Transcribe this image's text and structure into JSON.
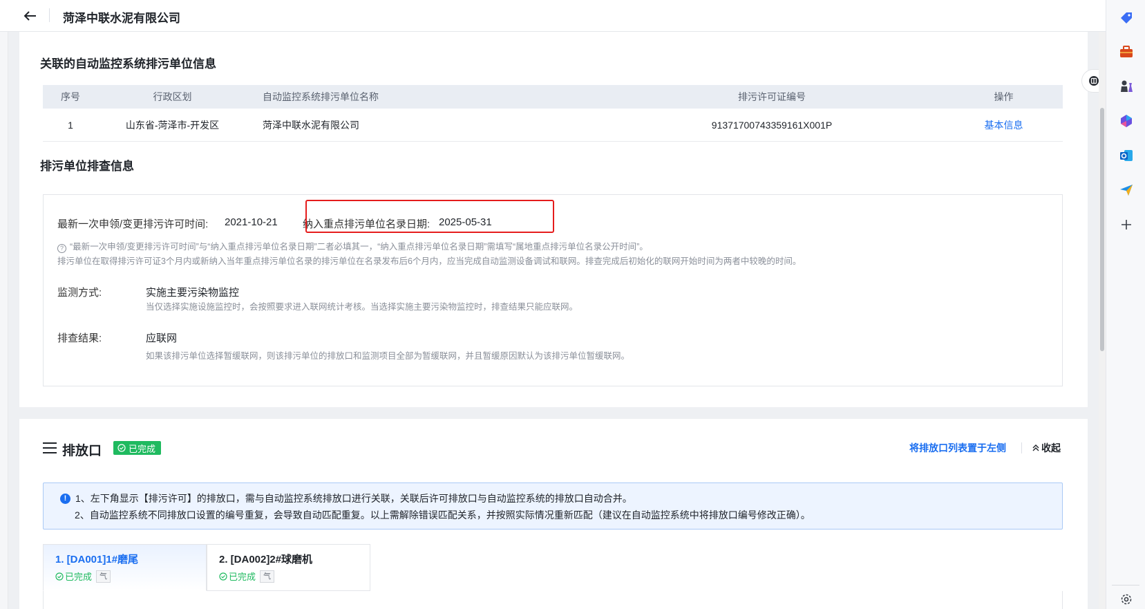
{
  "header": {
    "title": "菏泽中联水泥有限公司",
    "back_icon": "arrow-left-icon"
  },
  "linked_units": {
    "title": "关联的自动监控系统排污单位信息",
    "columns": [
      "序号",
      "行政区划",
      "自动监控系统排污单位名称",
      "排污许可证编号",
      "操作"
    ],
    "rows": [
      {
        "index": "1",
        "region": "山东省-菏泽市-开发区",
        "name": "菏泽中联水泥有限公司",
        "permit": "91371700743359161X001P",
        "action": "基本信息"
      }
    ]
  },
  "inspection": {
    "title": "排污单位排查信息",
    "latest_label": "最新一次申领/变更排污许可时间:",
    "latest_value": "2021-10-21",
    "key_label": "纳入重点排污单位名录日期:",
    "key_value": "2025-05-31",
    "hint1": "“最新一次申领/变更排污许可时间”与“纳入重点排污单位名录日期”二者必填其一，“纳入重点排污单位名录日期”需填写“属地重点排污单位名录公开时间”。",
    "hint2": "排污单位在取得排污许可证3个月内或新纳入当年重点排污单位名录的排污单位在名录发布后6个月内，应当完成自动监测设备调试和联网。排查完成后初始化的联网开始时间为两者中较晚的时间。",
    "method_label": "监测方式:",
    "method_value": "实施主要污染物监控",
    "method_hint": "当仅选择实施设施监控时，会按照要求进入联网统计考核。当选择实施主要污染物监控时，排查结果只能应联网。",
    "result_label": "排查结果:",
    "result_value": "应联网",
    "result_hint": "如果该排污单位选择暂缓联网，则该排污单位的排放口和监测项目全部为暂缓联网，并且暂缓原因默认为该排污单位暂缓联网。"
  },
  "outlets": {
    "title": "排放口",
    "status": "已完成",
    "left_link": "将排放口列表置于左侧",
    "collapse": "收起",
    "notice_line1": "1、左下角显示【排污许可】的排放口，需与自动监控系统排放口进行关联，关联后许可排放口与自动监控系统的排放口自动合并。",
    "notice_line2": "2、自动监控系统不同排放口设置的编号重复，会导致自动匹配重复。以上需解除错误匹配关系，并按照实际情况重新匹配（建议在自动监控系统中将排放口编号修改正确）。",
    "tabs": [
      {
        "name": "1. [DA001]1#磨尾",
        "status": "已完成",
        "tag": "气"
      },
      {
        "name": "2. [DA002]2#球磨机",
        "status": "已完成",
        "tag": "气"
      }
    ]
  },
  "sidebar": [
    "tag-icon",
    "toolbox-icon",
    "chess-icon",
    "copilot-icon",
    "outlook-icon",
    "send-icon",
    "plus-icon",
    "settings-icon"
  ],
  "colors": {
    "accent": "#1a6ef0",
    "success": "#1fba5f",
    "highlight": "#e51c1c"
  }
}
